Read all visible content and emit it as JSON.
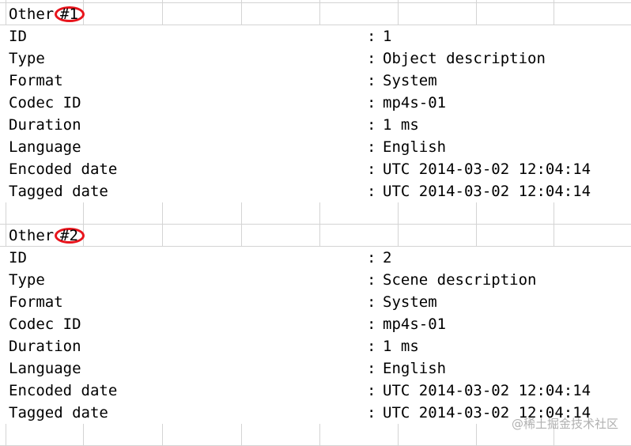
{
  "sections": [
    {
      "title": "Other",
      "number": "#1",
      "rows": [
        {
          "key": "ID",
          "colon": ":",
          "value": "1"
        },
        {
          "key": "Type",
          "colon": ":",
          "value": "Object description"
        },
        {
          "key": "Format",
          "colon": ":",
          "value": "System"
        },
        {
          "key": "Codec ID",
          "colon": ":",
          "value": "mp4s-01"
        },
        {
          "key": "Duration",
          "colon": ":",
          "value": "1 ms"
        },
        {
          "key": "Language",
          "colon": ":",
          "value": "English"
        },
        {
          "key": "Encoded date",
          "colon": ":",
          "value": "UTC 2014-03-02 12:04:14"
        },
        {
          "key": "Tagged date",
          "colon": ":",
          "value": "UTC 2014-03-02 12:04:14"
        }
      ]
    },
    {
      "title": "Other",
      "number": "#2",
      "rows": [
        {
          "key": "ID",
          "colon": ":",
          "value": "2"
        },
        {
          "key": "Type",
          "colon": ":",
          "value": "Scene description"
        },
        {
          "key": "Format",
          "colon": ":",
          "value": "System"
        },
        {
          "key": "Codec ID",
          "colon": ":",
          "value": "mp4s-01"
        },
        {
          "key": "Duration",
          "colon": ":",
          "value": "1 ms"
        },
        {
          "key": "Language",
          "colon": ":",
          "value": "English"
        },
        {
          "key": "Encoded date",
          "colon": ":",
          "value": "UTC 2014-03-02 12:04:14"
        },
        {
          "key": "Tagged date",
          "colon": ":",
          "value": "UTC 2014-03-02 12:04:14"
        }
      ]
    }
  ],
  "watermark": "@稀土掘金技术社区",
  "colors": {
    "gridline": "#d4d4d4",
    "highlight_circle": "#e8141c",
    "text": "#000000"
  }
}
